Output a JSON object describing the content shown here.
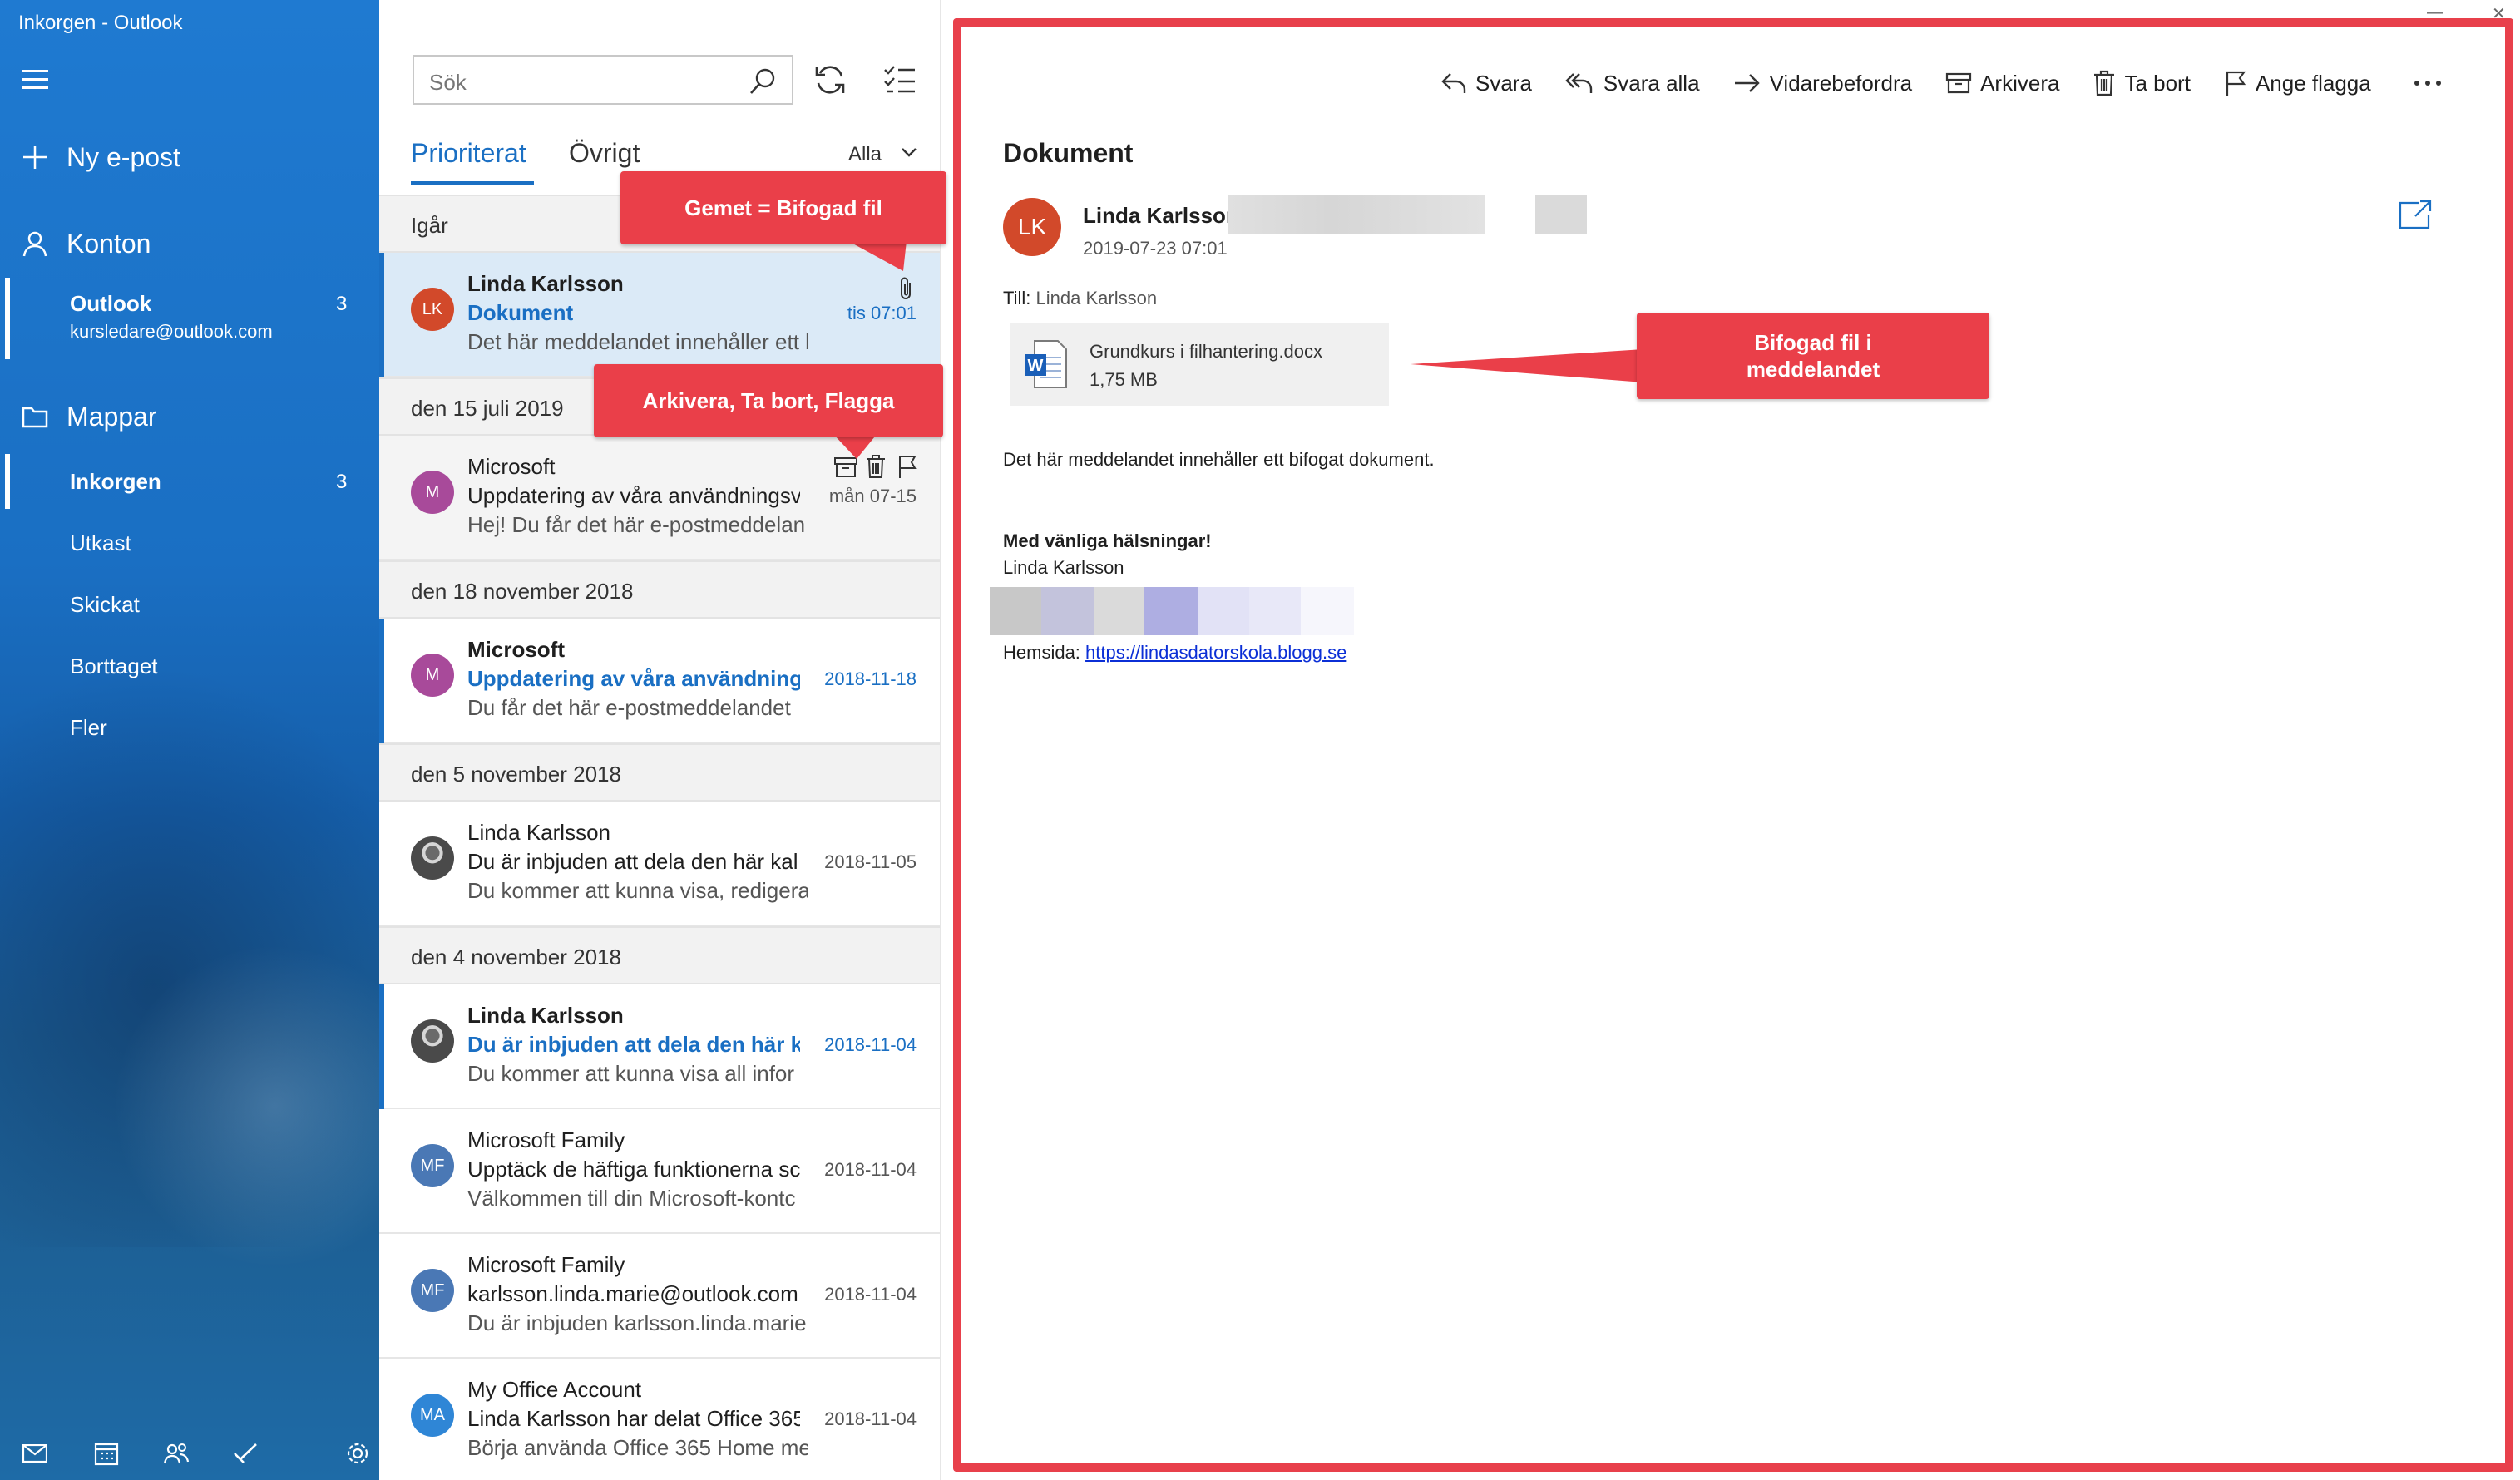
{
  "window": {
    "title": "Inkorgen - Outlook"
  },
  "nav": {
    "new_mail": "Ny e-post",
    "accounts_label": "Konton",
    "account": {
      "name": "Outlook",
      "email": "kursledare@outlook.com",
      "count": "3"
    },
    "folders_label": "Mappar",
    "folders": [
      {
        "label": "Inkorgen",
        "count": "3"
      },
      {
        "label": "Utkast"
      },
      {
        "label": "Skickat"
      },
      {
        "label": "Borttaget"
      },
      {
        "label": "Fler"
      }
    ]
  },
  "list": {
    "search_placeholder": "Sök",
    "tab_focused": "Prioriterat",
    "tab_other": "Övrigt",
    "filter": "Alla",
    "groups": [
      "Igår",
      "den 15 juli 2019",
      "den 18 november 2018",
      "den 5 november 2018",
      "den 4 november 2018"
    ],
    "messages": [
      {
        "initials": "LK",
        "from": "Linda Karlsson",
        "subject": "Dokument",
        "preview": "Det här meddelandet innehåller ett bi",
        "date": "tis 07:01",
        "color": "#d2492a"
      },
      {
        "initials": "M",
        "from": "Microsoft",
        "subject": "Uppdatering av våra användningsvil",
        "preview": "Hej! Du får det här e-postmeddelan",
        "date": "mån 07-15",
        "color": "#a84a9a"
      },
      {
        "initials": "M",
        "from": "Microsoft",
        "subject": "Uppdatering av våra användningsv",
        "preview": "Du får det här e-postmeddelandet",
        "date": "2018-11-18",
        "color": "#a84a9a"
      },
      {
        "initials": "",
        "from": "Linda Karlsson",
        "subject": "Du är inbjuden att dela den här kal",
        "preview": "Du kommer att kunna visa, redigera",
        "date": "2018-11-05",
        "color": "#555555"
      },
      {
        "initials": "",
        "from": "Linda Karlsson",
        "subject": "Du är inbjuden att dela den här ka",
        "preview": "Du kommer att kunna visa all infor",
        "date": "2018-11-04",
        "color": "#555555"
      },
      {
        "initials": "MF",
        "from": "Microsoft Family",
        "subject": "Upptäck de häftiga funktionerna sc",
        "preview": "Välkommen till din Microsoft-kontc",
        "date": "2018-11-04",
        "color": "#4a78b5"
      },
      {
        "initials": "MF",
        "from": "Microsoft Family",
        "subject": "karlsson.linda.marie@outlook.com",
        "preview": "Du är inbjuden karlsson.linda.marie",
        "date": "2018-11-04",
        "color": "#4a78b5"
      },
      {
        "initials": "MA",
        "from": "My Office Account",
        "subject": "Linda Karlsson har delat Office 365",
        "preview": "Börja använda Office 365 Home me",
        "date": "2018-11-04",
        "color": "#2f86d6"
      }
    ]
  },
  "reading": {
    "commands": [
      "Svara",
      "Svara alla",
      "Vidarebefordra",
      "Arkivera",
      "Ta bort",
      "Ange flagga"
    ],
    "subject": "Dokument",
    "sender_initials": "LK",
    "sender": "Linda Karlsson",
    "date": "2019-07-23 07:01",
    "to_label": "Till:",
    "to": "Linda Karlsson",
    "attachment": {
      "name": "Grundkurs i filhantering.docx",
      "size": "1,75 MB"
    },
    "body": "Det här meddelandet innehåller ett bifogat dokument.",
    "greeting": "Med vänliga hälsningar!",
    "signature": "Linda Karlsson",
    "homepage_label": "Hemsida:",
    "homepage_url": "https://lindasdatorskola.blogg.se"
  },
  "callouts": {
    "clip": "Gemet = Bifogad fil",
    "actions": "Arkivera, Ta bort, Flagga",
    "attachment": "Bifogad fil i meddelandet"
  },
  "colors": {
    "accent": "#1a6fc3",
    "callout": "#ea3f49"
  }
}
